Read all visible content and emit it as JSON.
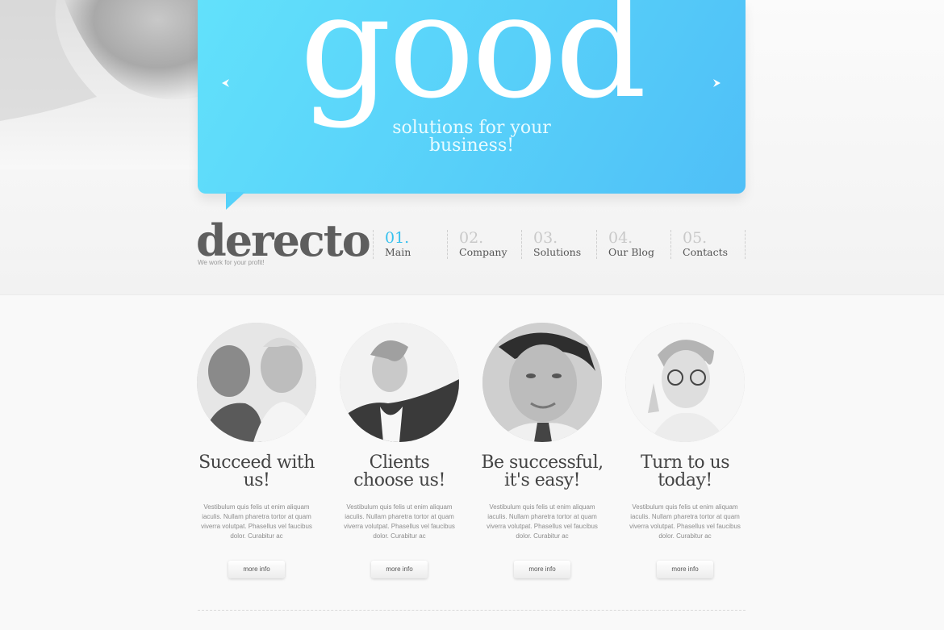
{
  "hero": {
    "headline": "good",
    "tagline_line1": "solutions for your",
    "tagline_line2": "business!"
  },
  "brand": {
    "logo": "derecto",
    "tagline": "We work for your profit!"
  },
  "nav": {
    "items": [
      {
        "number": "01.",
        "label": "Main",
        "active": true
      },
      {
        "number": "02.",
        "label": "Company",
        "active": false
      },
      {
        "number": "03.",
        "label": "Solutions",
        "active": false
      },
      {
        "number": "04.",
        "label": "Our Blog",
        "active": false
      },
      {
        "number": "05.",
        "label": "Contacts",
        "active": false
      }
    ]
  },
  "features": [
    {
      "title_line1": "Succeed with",
      "title_line2": "us!",
      "text": "Vestibulum quis felis ut enim aliquam iaculis. Nullam pharetra tortor at quam viverra volutpat. Phasellus vel faucibus dolor. Curabitur ac",
      "button": "more info"
    },
    {
      "title_line1": "Clients",
      "title_line2": "choose us!",
      "text": "Vestibulum quis felis ut enim aliquam iaculis. Nullam pharetra tortor at quam viverra volutpat. Phasellus vel faucibus dolor. Curabitur ac",
      "button": "more info"
    },
    {
      "title_line1": "Be successful,",
      "title_line2": "it's easy!",
      "text": "Vestibulum quis felis ut enim aliquam iaculis. Nullam pharetra tortor at quam viverra volutpat. Phasellus vel faucibus dolor. Curabitur ac",
      "button": "more info"
    },
    {
      "title_line1": "Turn to us",
      "title_line2": "today!",
      "text": "Vestibulum quis felis ut enim aliquam iaculis. Nullam pharetra tortor at quam viverra volutpat. Phasellus vel faucibus dolor. Curabitur ac",
      "button": "more info"
    }
  ],
  "colors": {
    "hero_blue": "#57cff9",
    "nav_active": "#37c1ef"
  },
  "icons": {
    "prev": "arrow-left-icon",
    "next": "arrow-right-icon"
  }
}
